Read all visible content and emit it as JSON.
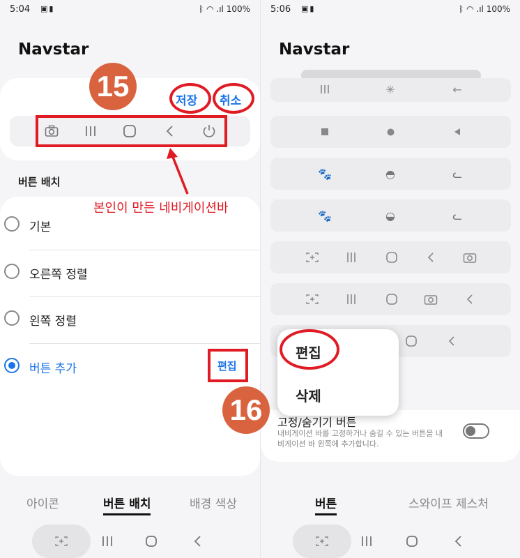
{
  "left": {
    "status": {
      "time": "5:04",
      "battery": "100%",
      "icons": "bluetooth wifi signal"
    },
    "title": "Navstar",
    "callout": "15",
    "save": "저장",
    "cancel": "취소",
    "preview_icons": [
      "camera-icon",
      "recents-icon",
      "home-icon",
      "back-icon",
      "power-icon"
    ],
    "note": "본인이 만든 네비게이션바",
    "section": "버튼 배치",
    "options": [
      {
        "label": "기본",
        "selected": false
      },
      {
        "label": "오른쪽 정렬",
        "selected": false
      },
      {
        "label": "왼쪽 정렬",
        "selected": false
      },
      {
        "label": "버튼 추가",
        "selected": true
      }
    ],
    "edit": "편집",
    "tabs": [
      "아이콘",
      "버튼 배치",
      "배경 색상"
    ],
    "active_tab": "버튼 배치",
    "accent": "#1a73e8",
    "annotation_color": "#e01b24"
  },
  "right": {
    "status": {
      "time": "5:06",
      "battery": "100%"
    },
    "title": "Navstar",
    "callout": "16",
    "popup": {
      "edit": "편집",
      "delete": "삭제"
    },
    "setting": {
      "title": "고정/숨기기 버튼",
      "desc": "내비게이션 바를 고정하거나 숨길 수 있는 버튼을 내비게이션 바 왼쪽에 추가합니다.",
      "enabled": false
    },
    "tabs": [
      "버튼",
      "스와이프 제스처"
    ],
    "active_tab": "버튼"
  }
}
